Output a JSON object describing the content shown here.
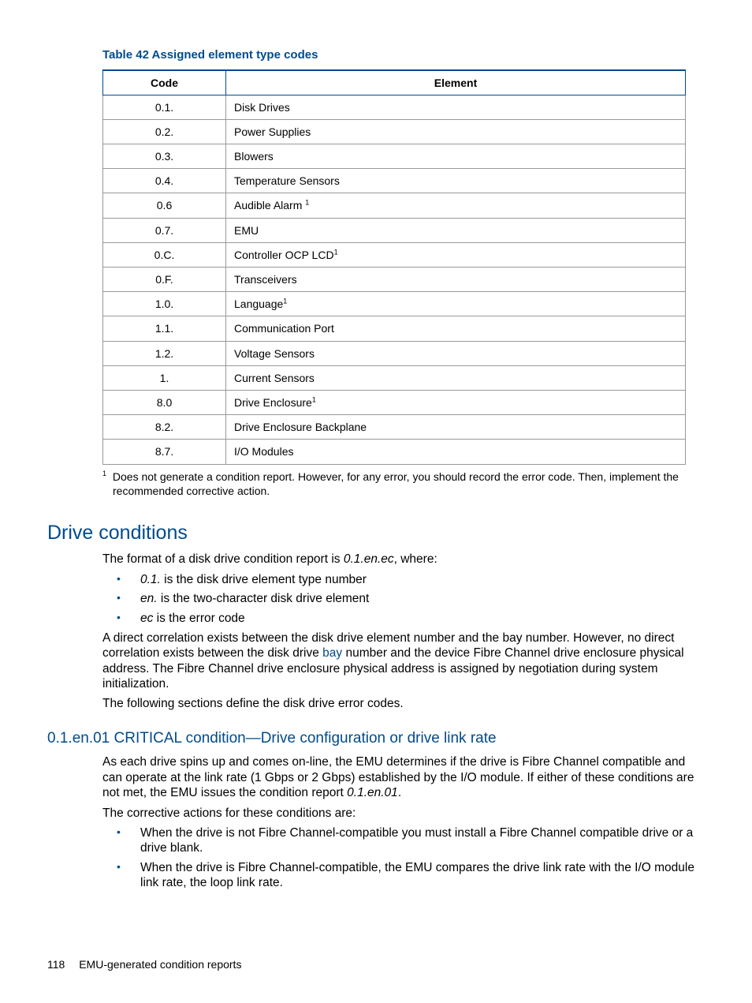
{
  "table": {
    "caption": "Table 42 Assigned element type codes",
    "headers": [
      "Code",
      "Element"
    ],
    "rows": [
      {
        "code": "0.1.",
        "element": "Disk Drives",
        "sup": ""
      },
      {
        "code": "0.2.",
        "element": "Power Supplies",
        "sup": ""
      },
      {
        "code": "0.3.",
        "element": "Blowers",
        "sup": ""
      },
      {
        "code": "0.4.",
        "element": "Temperature Sensors",
        "sup": ""
      },
      {
        "code": "0.6",
        "element": "Audible Alarm ",
        "sup": "1"
      },
      {
        "code": "0.7.",
        "element": "EMU",
        "sup": ""
      },
      {
        "code": "0.C.",
        "element": "Controller OCP LCD",
        "sup": "1"
      },
      {
        "code": "0.F.",
        "element": "Transceivers",
        "sup": ""
      },
      {
        "code": "1.0.",
        "element": "Language",
        "sup": "1"
      },
      {
        "code": "1.1.",
        "element": "Communication Port",
        "sup": ""
      },
      {
        "code": "1.2.",
        "element": "Voltage Sensors",
        "sup": ""
      },
      {
        "code": "1.",
        "element": "Current Sensors",
        "sup": ""
      },
      {
        "code": "8.0",
        "element": "Drive Enclosure",
        "sup": "1"
      },
      {
        "code": "8.2.",
        "element": "Drive Enclosure Backplane",
        "sup": ""
      },
      {
        "code": "8.7.",
        "element": "I/O Modules",
        "sup": ""
      }
    ],
    "footnote_num": "1",
    "footnote_text": "Does not generate a condition report. However, for any error, you should record the error code. Then, implement the recommended corrective action."
  },
  "sec1": {
    "title": "Drive conditions",
    "p1_pre": "The format of a disk drive condition report is ",
    "p1_em": "0.1.en.ec",
    "p1_post": ", where:",
    "bul1_em": "0.1.",
    "bul1_txt": " is the disk drive element type number",
    "bul2_em": "en.",
    "bul2_txt": " is the two-character disk drive element",
    "bul3_em": "ec",
    "bul3_txt": " is the error code",
    "p2_a": "A direct correlation exists between the disk drive element number and the bay number. However, no direct correlation exists between the disk drive ",
    "p2_link": "bay",
    "p2_b": " number and the device Fibre Channel drive enclosure physical address. The Fibre Channel drive enclosure physical address is assigned by negotiation during system initialization.",
    "p3": "The following sections define the disk drive error codes."
  },
  "sec2": {
    "title": "0.1.en.01 CRITICAL condition—Drive configuration or drive link rate",
    "p1_a": "As each drive spins up and comes on-line, the EMU determines if the drive is Fibre Channel compatible and can operate at the link rate (1 Gbps or 2 Gbps) established by the I/O module. If either of these conditions are not met, the EMU issues the condition report ",
    "p1_em": "0.1.en.01",
    "p1_b": ".",
    "p2": "The corrective actions for these conditions are:",
    "bul1": "When the drive is not Fibre Channel-compatible you must install a Fibre Channel compatible drive or a drive blank.",
    "bul2": "When the drive is Fibre Channel-compatible, the EMU compares the drive link rate with the I/O module link rate, the loop link rate."
  },
  "footer": {
    "page": "118",
    "title": "EMU-generated condition reports"
  }
}
